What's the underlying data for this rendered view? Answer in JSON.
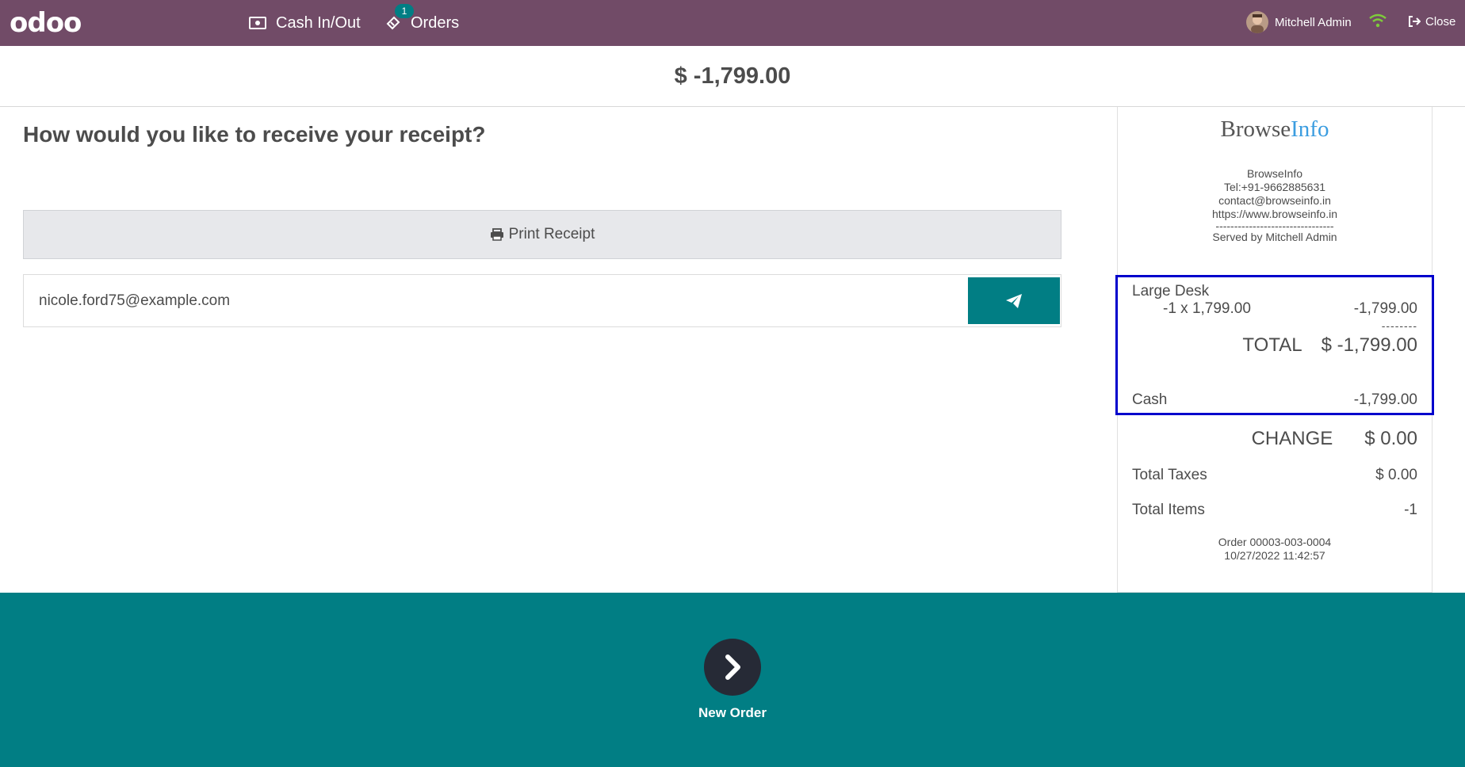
{
  "topbar": {
    "logo": "odoo",
    "cash_label": "Cash In/Out",
    "orders_label": "Orders",
    "orders_badge": "1",
    "user_name": "Mitchell Admin",
    "close_label": "Close"
  },
  "header": {
    "amount": "$ -1,799.00"
  },
  "main": {
    "question": "How would you like to receive your receipt?",
    "print_label": "Print Receipt",
    "email_value": "nicole.ford75@example.com"
  },
  "receipt": {
    "logo_part1": "Browse",
    "logo_part2": "Info",
    "company": "BrowseInfo",
    "tel": "Tel:+91-9662885631",
    "email": "contact@browseinfo.in",
    "website": "https://www.browseinfo.in",
    "separator": "--------------------------------",
    "served_by": "Served by Mitchell Admin",
    "product_name": "Large Desk",
    "product_qty": "-1 x 1,799.00",
    "product_amount": "-1,799.00",
    "dash_line": "--------",
    "total_label": "TOTAL",
    "total_value": "$ -1,799.00",
    "payment_label": "Cash",
    "payment_value": "-1,799.00",
    "change_label": "CHANGE",
    "change_value": "$ 0.00",
    "taxes_label": "Total Taxes",
    "taxes_value": "$ 0.00",
    "items_label": "Total Items",
    "items_value": "-1",
    "order_ref": "Order 00003-003-0004",
    "order_date": "10/27/2022 11:42:57"
  },
  "footer": {
    "new_order_label": "New Order"
  },
  "colors": {
    "topbar": "#714b67",
    "accent": "#017e84",
    "highlight": "#0000cc"
  }
}
